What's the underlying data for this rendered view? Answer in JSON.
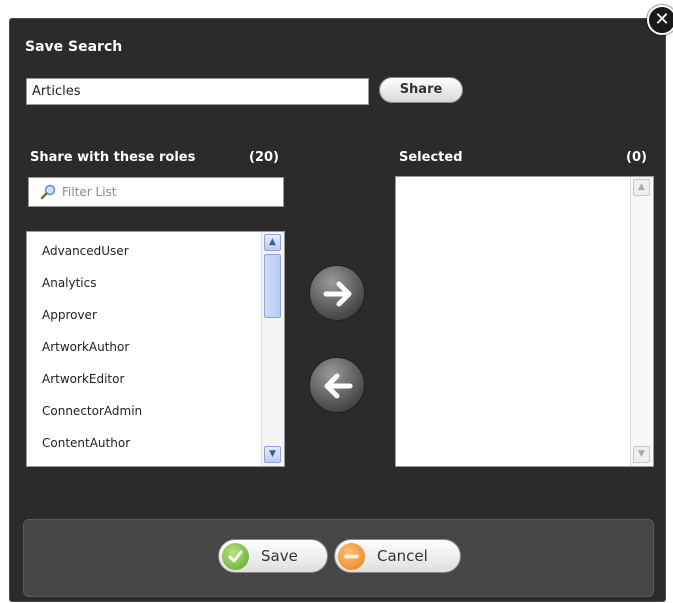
{
  "dialog": {
    "title": "Save Search",
    "close_icon": "close-icon",
    "search_name_value": "Articles",
    "share_label": "Share"
  },
  "roles": {
    "heading": "Share with these roles",
    "count": "(20)",
    "filter_placeholder": "Filter List",
    "items": [
      "AdvancedUser",
      "Analytics",
      "Approver",
      "ArtworkAuthor",
      "ArtworkEditor",
      "ConnectorAdmin",
      "ContentAuthor"
    ]
  },
  "selected": {
    "heading": "Selected",
    "count": "(0)"
  },
  "controls": {
    "move_right_icon": "arrow-right-icon",
    "move_left_icon": "arrow-left-icon"
  },
  "footer": {
    "save_label": "Save",
    "cancel_label": "Cancel"
  },
  "colors": {
    "dialog_bg": "#2b2b2b",
    "footer_bg": "#464646",
    "save_icon": "#6fbf2f",
    "cancel_icon": "#f08a1c"
  }
}
